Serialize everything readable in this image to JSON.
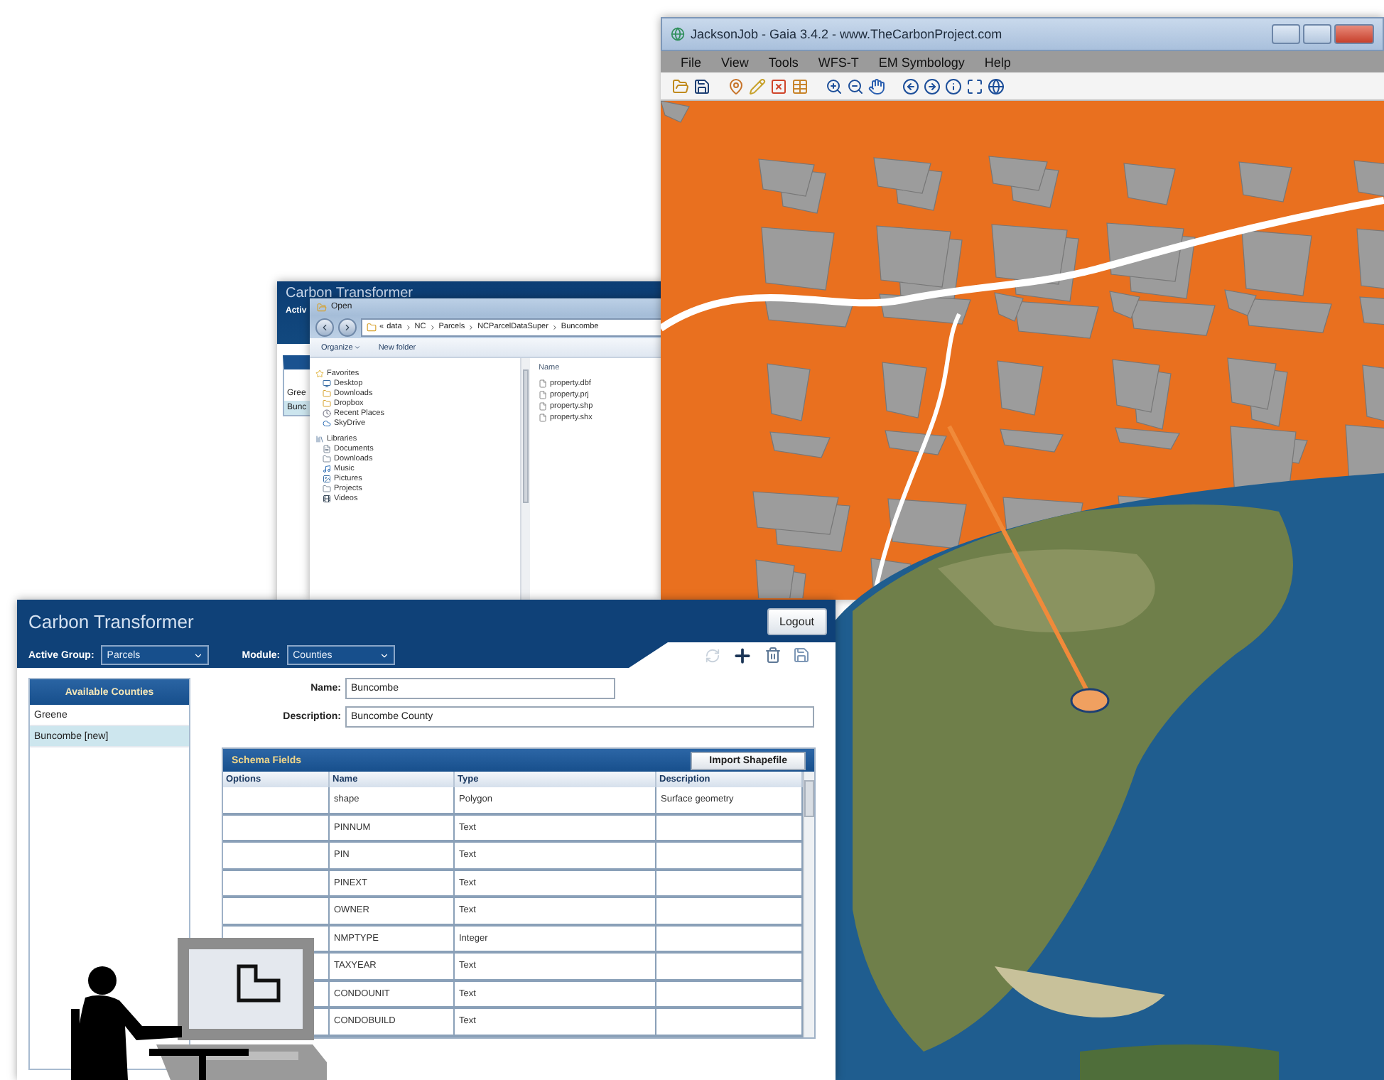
{
  "map_window": {
    "title": "JacksonJob - Gaia 3.4.2 - www.TheCarbonProject.com",
    "menu": [
      "File",
      "View",
      "Tools",
      "WFS-T",
      "EM Symbology",
      "Help"
    ]
  },
  "back_window": {
    "title": "Carbon Transformer",
    "active_group_label": "Activ",
    "list_items": [
      {
        "label": "Gree",
        "selected": false
      },
      {
        "label": "Bunc",
        "selected": true
      }
    ]
  },
  "open_dialog": {
    "title": "Open",
    "path_prefix": "«",
    "path": [
      "data",
      "NC",
      "Parcels",
      "NCParcelDataSuper",
      "Buncombe"
    ],
    "toolbar": [
      "Organize",
      "New folder"
    ],
    "nav": [
      {
        "label": "Favorites",
        "children": [
          {
            "label": "Desktop"
          },
          {
            "label": "Downloads"
          },
          {
            "label": "Dropbox"
          },
          {
            "label": "Recent Places"
          },
          {
            "label": "SkyDrive"
          }
        ]
      },
      {
        "label": "Libraries",
        "children": [
          {
            "label": "Documents"
          },
          {
            "label": "Downloads"
          },
          {
            "label": "Music"
          },
          {
            "label": "Pictures"
          },
          {
            "label": "Projects"
          },
          {
            "label": "Videos"
          }
        ]
      }
    ],
    "files_header": "Name",
    "files": [
      "property.dbf",
      "property.prj",
      "property.shp",
      "property.shx"
    ]
  },
  "transformer": {
    "title": "Carbon Transformer",
    "logout": "Logout",
    "active_group": {
      "label": "Active Group:",
      "value": "Parcels"
    },
    "module": {
      "label": "Module:",
      "value": "Counties"
    },
    "counties": {
      "header": "Available Counties",
      "items": [
        {
          "label": "Greene",
          "selected": false
        },
        {
          "label": "Buncombe [new]",
          "selected": true
        }
      ]
    },
    "name": {
      "label": "Name:",
      "value": "Buncombe"
    },
    "description": {
      "label": "Description:",
      "value": "Buncombe County"
    },
    "schema": {
      "title": "Schema Fields",
      "import_button": "Import Shapefile",
      "columns": [
        "Options",
        "Name",
        "Type",
        "Description"
      ],
      "rows": [
        {
          "name": "shape",
          "type": "Polygon",
          "description": "Surface geometry"
        },
        {
          "name": "PINNUM",
          "type": "Text"
        },
        {
          "name": "PIN",
          "type": "Text"
        },
        {
          "name": "PINEXT",
          "type": "Text"
        },
        {
          "name": "OWNER",
          "type": "Text"
        },
        {
          "name": "NMPTYPE",
          "type": "Integer"
        },
        {
          "name": "TAXYEAR",
          "type": "Text"
        },
        {
          "name": "CONDOUNIT",
          "type": "Text"
        },
        {
          "name": "CONDOBUILD",
          "type": "Text"
        }
      ]
    }
  }
}
